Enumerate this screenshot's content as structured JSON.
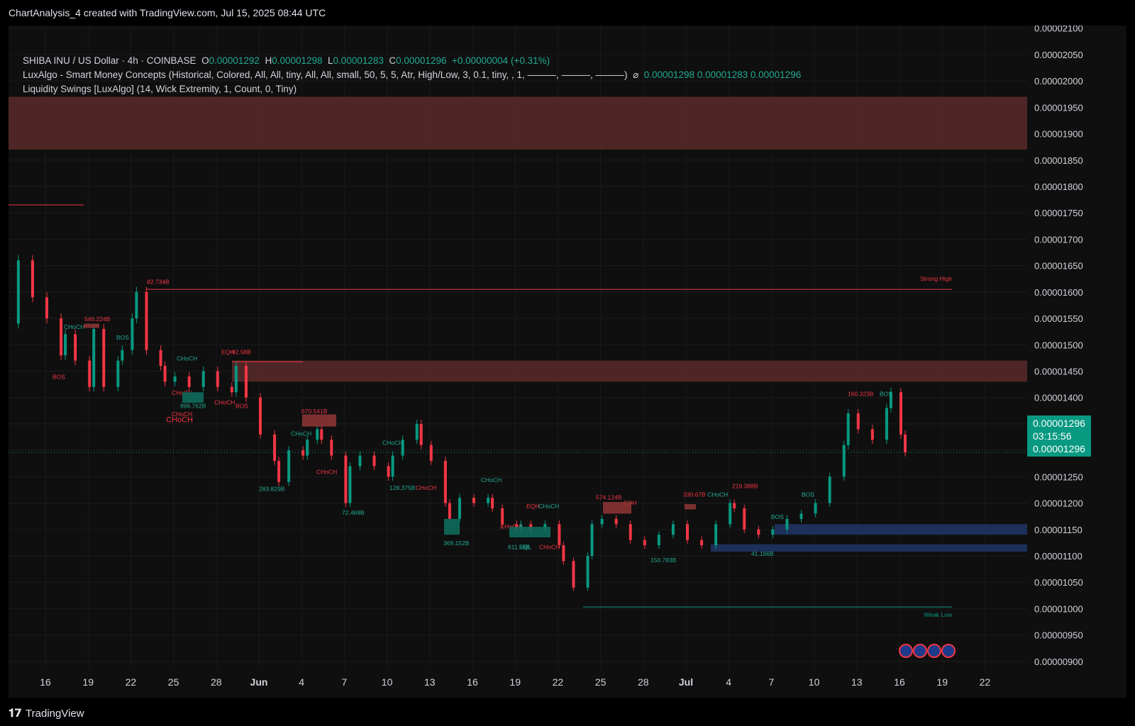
{
  "header": {
    "title": "ChartAnalysis_4 created with TradingView.com, Jul 15, 2025 08:44 UTC"
  },
  "legend": {
    "symbol": "SHIBA INU / US Dollar · 4h · COINBASE",
    "o_label": "O",
    "o_value": "0.00001292",
    "h_label": "H",
    "h_value": "0.00001298",
    "l_label": "L",
    "l_value": "0.00001283",
    "c_label": "C",
    "c_value": "0.00001296",
    "change": "+0.00000004 (+0.31%)",
    "indicator1": "LuxAlgo - Smart Money Concepts (Historical, Colored, All, All, tiny, All, All, small, 50, 5, 5, Atr, High/Low, 3, 0.1, tiny, , 1, ———, ———, ———)",
    "indicator1_symbol": "⌀",
    "indicator1_values": "0.00001298  0.00001283  0.00001296",
    "indicator2": "Liquidity Swings [LuxAlgo] (14, Wick Extremity, 1, Count, 0, Tiny)"
  },
  "price_box": {
    "price": "0.00001296",
    "countdown": "03:15:56",
    "price2": "0.00001296"
  },
  "brand": {
    "name": "TradingView"
  },
  "colors": {
    "up": "#089981",
    "down": "#f23645",
    "background": "#0f0f0f",
    "grid": "#1e1e1e",
    "zone_red": "#5b2a2a",
    "zone_blue": "#1f3462"
  },
  "chart_data": {
    "type": "candlestick",
    "title": "SHIBA INU / US Dollar · 4h · COINBASE",
    "ylim": [
      8.85e-06,
      2.105e-05
    ],
    "y_ticks": [
      "0.00002100",
      "0.00002050",
      "0.00002000",
      "0.00001950",
      "0.00001900",
      "0.00001850",
      "0.00001800",
      "0.00001750",
      "0.00001700",
      "0.00001650",
      "0.00001600",
      "0.00001550",
      "0.00001500",
      "0.00001450",
      "0.00001400",
      "0.00001350",
      "0.00001300",
      "0.00001250",
      "0.00001200",
      "0.00001150",
      "0.00001100",
      "0.00001050",
      "0.00001000",
      "0.00000950",
      "0.00000900"
    ],
    "x_ticks": [
      "16",
      "19",
      "22",
      "25",
      "28",
      "Jun",
      "4",
      "7",
      "10",
      "13",
      "16",
      "19",
      "22",
      "25",
      "28",
      "Jul",
      "4",
      "7",
      "10",
      "13",
      "16",
      "19",
      "22"
    ],
    "price_path": [
      [
        "May 14",
        1.54e-05
      ],
      [
        "May 14",
        1.66e-05
      ],
      [
        "May 15",
        1.59e-05
      ],
      [
        "May 16",
        1.55e-05
      ],
      [
        "May 17",
        1.48e-05
      ],
      [
        "May 17",
        1.52e-05
      ],
      [
        "May 18",
        1.47e-05
      ],
      [
        "May 19",
        1.42e-05
      ],
      [
        "May 19",
        1.53e-05
      ],
      [
        "May 20",
        1.42e-05
      ],
      [
        "May 21",
        1.47e-05
      ],
      [
        "May 21",
        1.49e-05
      ],
      [
        "May 22",
        1.55e-05
      ],
      [
        "May 22",
        1.6e-05
      ],
      [
        "May 23",
        1.49e-05
      ],
      [
        "May 24",
        1.46e-05
      ],
      [
        "May 24",
        1.43e-05
      ],
      [
        "May 25",
        1.44e-05
      ],
      [
        "May 26",
        1.42e-05
      ],
      [
        "May 27",
        1.45e-05
      ],
      [
        "May 28",
        1.42e-05
      ],
      [
        "May 29",
        1.41e-05
      ],
      [
        "May 29",
        1.46e-05
      ],
      [
        "May 30",
        1.4e-05
      ],
      [
        "May 31",
        1.33e-05
      ],
      [
        "Jun 1",
        1.28e-05
      ],
      [
        "Jun 1",
        1.24e-05
      ],
      [
        "Jun 2",
        1.3e-05
      ],
      [
        "Jun 3",
        1.29e-05
      ],
      [
        "Jun 3",
        1.32e-05
      ],
      [
        "Jun 4",
        1.34e-05
      ],
      [
        "Jun 4",
        1.32e-05
      ],
      [
        "Jun 5",
        1.29e-05
      ],
      [
        "Jun 6",
        1.2e-05
      ],
      [
        "Jun 6",
        1.27e-05
      ],
      [
        "Jun 7",
        1.29e-05
      ],
      [
        "Jun 8",
        1.27e-05
      ],
      [
        "Jun 9",
        1.25e-05
      ],
      [
        "Jun 9",
        1.29e-05
      ],
      [
        "Jun 10",
        1.32e-05
      ],
      [
        "Jun 11",
        1.35e-05
      ],
      [
        "Jun 11",
        1.31e-05
      ],
      [
        "Jun 12",
        1.28e-05
      ],
      [
        "Jun 13",
        1.2e-05
      ],
      [
        "Jun 13",
        1.17e-05
      ],
      [
        "Jun 14",
        1.21e-05
      ],
      [
        "Jun 15",
        1.2e-05
      ],
      [
        "Jun 16",
        1.21e-05
      ],
      [
        "Jun 16",
        1.19e-05
      ],
      [
        "Jun 17",
        1.16e-05
      ],
      [
        "Jun 18",
        1.15e-05
      ],
      [
        "Jun 18",
        1.16e-05
      ],
      [
        "Jun 19",
        1.15e-05
      ],
      [
        "Jun 20",
        1.16e-05
      ],
      [
        "Jun 21",
        1.12e-05
      ],
      [
        "Jun 21",
        1.09e-05
      ],
      [
        "Jun 22",
        1.04e-05
      ],
      [
        "Jun 23",
        1.1e-05
      ],
      [
        "Jun 23",
        1.16e-05
      ],
      [
        "Jun 24",
        1.17e-05
      ],
      [
        "Jun 25",
        1.16e-05
      ],
      [
        "Jun 26",
        1.13e-05
      ],
      [
        "Jun 27",
        1.12e-05
      ],
      [
        "Jun 28",
        1.14e-05
      ],
      [
        "Jun 29",
        1.16e-05
      ],
      [
        "Jun 30",
        1.13e-05
      ],
      [
        "Jul 1",
        1.12e-05
      ],
      [
        "Jul 2",
        1.16e-05
      ],
      [
        "Jul 3",
        1.2e-05
      ],
      [
        "Jul 3",
        1.19e-05
      ],
      [
        "Jul 4",
        1.15e-05
      ],
      [
        "Jul 5",
        1.14e-05
      ],
      [
        "Jul 6",
        1.15e-05
      ],
      [
        "Jul 7",
        1.17e-05
      ],
      [
        "Jul 8",
        1.18e-05
      ],
      [
        "Jul 9",
        1.2e-05
      ],
      [
        "Jul 10",
        1.25e-05
      ],
      [
        "Jul 11",
        1.31e-05
      ],
      [
        "Jul 11",
        1.37e-05
      ],
      [
        "Jul 12",
        1.34e-05
      ],
      [
        "Jul 13",
        1.32e-05
      ],
      [
        "Jul 14",
        1.38e-05
      ],
      [
        "Jul 14",
        1.41e-05
      ],
      [
        "Jul 15",
        1.33e-05
      ],
      [
        "Jul 15",
        1.296e-05
      ]
    ],
    "zones": [
      {
        "kind": "supply",
        "from": 1.87e-05,
        "to": 1.97e-05
      },
      {
        "kind": "supply",
        "from": 1.43e-05,
        "to": 1.47e-05
      },
      {
        "kind": "demand",
        "from": 1.14e-05,
        "to": 1.16e-05
      },
      {
        "kind": "demand",
        "from": 1.108e-05,
        "to": 1.122e-05
      }
    ],
    "levels": [
      {
        "label": "Strong High",
        "value": 1.605e-05
      },
      {
        "label": "Weak Low",
        "value": 1.003e-05
      }
    ],
    "annotations": [
      "82.734B",
      "546.224B",
      "CHoCH",
      "BOS",
      "CHoCH",
      "EQH",
      "92.58B",
      "CHoCH",
      "896.762B",
      "CHoCH",
      "BOS",
      "CHoCH",
      "670.541B",
      "CHoCH",
      "CHoCH",
      "CHoCH",
      "283.829B",
      "72.469B",
      "128.375B",
      "CHoCH",
      "CHoCH",
      "369.152B",
      "EQH",
      "CHoCH",
      "CHoCH",
      "611.59B",
      "EQL",
      "CHoCH",
      "574.124B",
      "EQH",
      "330.67B",
      "CHoCH",
      "219.388B",
      "BOS",
      "BOS",
      "150.783B",
      "41.196B",
      "160.323B",
      "BOS",
      "Strong High",
      "Weak Low"
    ]
  }
}
